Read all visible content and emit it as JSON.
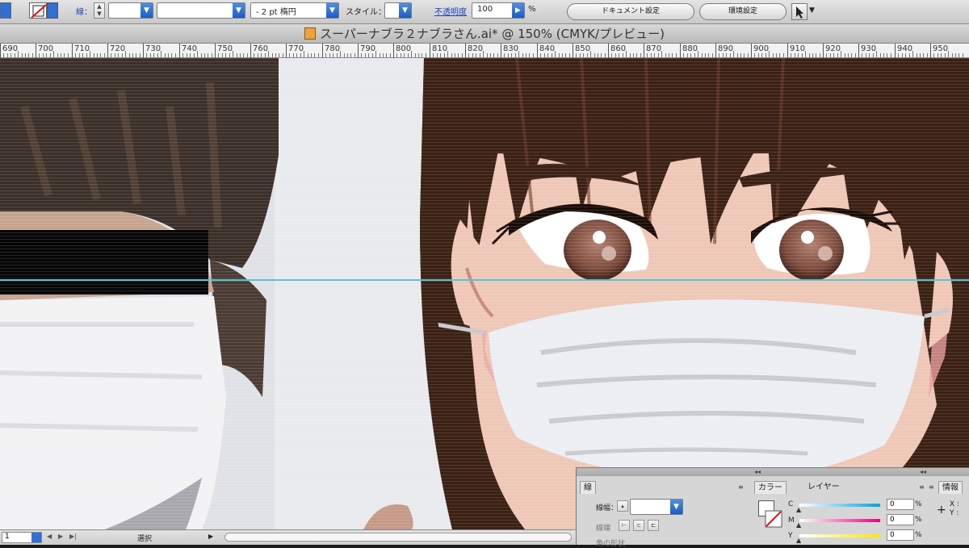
{
  "control_bar": {
    "stroke_label": "線：",
    "stroke_weight": "",
    "brush_value": "",
    "profile_value": "- 2 pt 楕円",
    "style_label": "スタイル：",
    "opacity_label": "不透明度",
    "opacity_value": "100",
    "percent": "%",
    "document_setup": "ドキュメント設定",
    "preferences": "環境設定"
  },
  "title_bar": {
    "title": "スーパーナブラ２ナブラさん.ai* @ 150% (CMYK/プレビュー)"
  },
  "ruler": {
    "labels": [
      "690",
      "700",
      "710",
      "720",
      "730",
      "740",
      "750",
      "760",
      "770",
      "780",
      "790",
      "800",
      "810",
      "820",
      "830",
      "840",
      "850",
      "860",
      "870",
      "880",
      "890",
      "900",
      "910",
      "920",
      "930",
      "940",
      "950"
    ]
  },
  "status_bar": {
    "zoom": "1",
    "mode": "選択"
  },
  "panels": {
    "stroke_tab": "線",
    "color_tab": "カラー",
    "layer_tab": "レイヤー",
    "info_tab": "情報",
    "stroke_weight_label": "線幅：",
    "cap_label": "線端",
    "corner_label": "角の形状",
    "c_label": "C",
    "m_label": "M",
    "y_label": "Y",
    "c_value": "0",
    "m_value": "0",
    "y_value": "0",
    "pct": "%",
    "info_x": "X :",
    "info_y": "Y :"
  },
  "colors": {
    "hair": "#3b2014",
    "skin": "#eec7b6",
    "mask": "#eceef3",
    "guide": "#58c4d8",
    "accent": "#1d5bc4"
  }
}
